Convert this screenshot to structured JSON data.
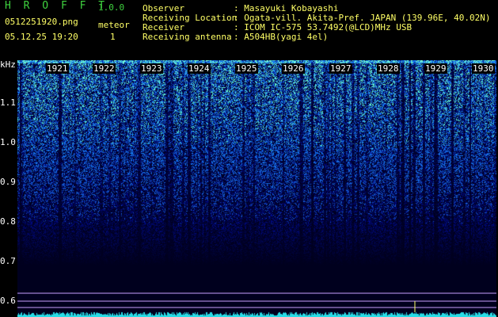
{
  "app": {
    "title": "H R O F F T",
    "version": "1.0.0",
    "filename": "0512251920.png",
    "datetime": "05.12.25 19:20",
    "meteor_label": "meteor",
    "meteor_count": "1"
  },
  "info": {
    "observer_label": "Observer",
    "observer_value": ": Masayuki Kobayashi",
    "location_label": "Receiving Location",
    "location_value": ": Ogata-vill. Akita-Pref. JAPAN (139.96E, 40.02N)",
    "receiver_label": "Receiver",
    "receiver_value": ": ICOM IC-575 53.7492(@LCD)MHz USB",
    "antenna_label": "Receiving antenna",
    "antenna_value": ": A504HB(yagi 4el)"
  },
  "spectrogram": {
    "y_unit": "kHz",
    "y_ticks": [
      "1.1",
      "1.0",
      "0.9",
      "0.8",
      "0.7",
      "0.6"
    ],
    "x_labels": [
      "1921",
      "1922",
      "1923",
      "1924",
      "1925",
      "1926",
      "1927",
      "1928",
      "1929",
      "1930"
    ],
    "colors": {
      "background": "#000000",
      "signal_low": "#000a3c",
      "signal_mid": "#1a3cff",
      "signal_high": "#40e0d0",
      "grid_line": "#c8a0ff"
    }
  }
}
